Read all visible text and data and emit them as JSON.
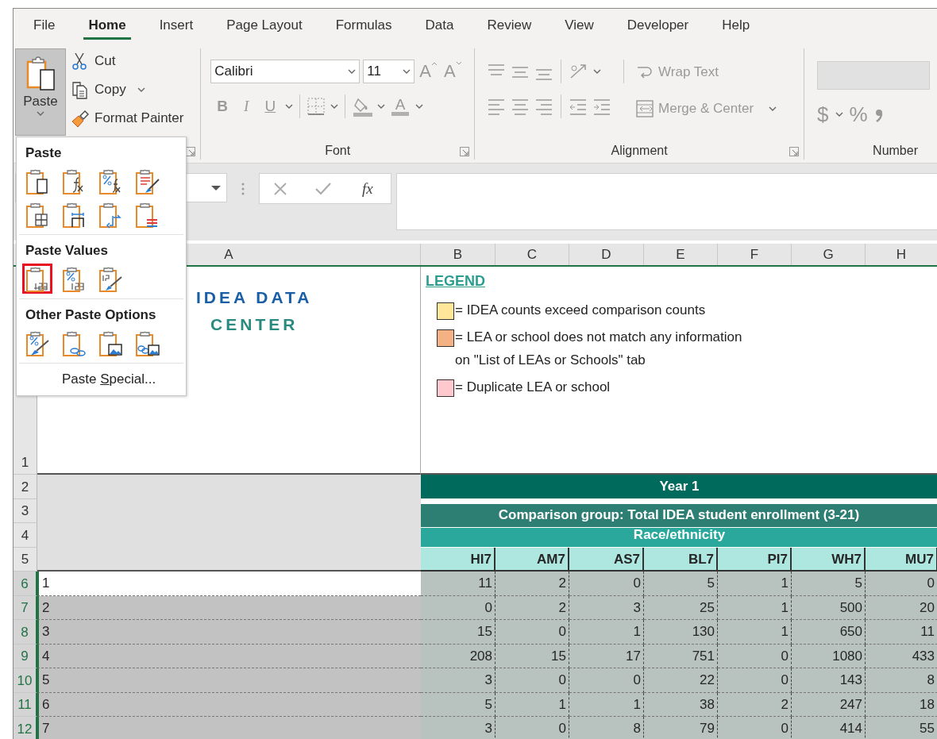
{
  "ribbon_tabs": [
    {
      "label": "File",
      "selected": false
    },
    {
      "label": "Home",
      "selected": true
    },
    {
      "label": "Insert",
      "selected": false
    },
    {
      "label": "Page Layout",
      "selected": false
    },
    {
      "label": "Formulas",
      "selected": false
    },
    {
      "label": "Data",
      "selected": false
    },
    {
      "label": "Review",
      "selected": false
    },
    {
      "label": "View",
      "selected": false
    },
    {
      "label": "Developer",
      "selected": false
    },
    {
      "label": "Help",
      "selected": false
    }
  ],
  "clipboard": {
    "paste": {
      "label": "Paste",
      "pressed": true
    },
    "commands": [
      {
        "kind": "cut",
        "label": "Cut",
        "has_menu": false
      },
      {
        "kind": "copy",
        "label": "Copy",
        "has_menu": true
      },
      {
        "kind": "format_painter",
        "label": "Format Painter",
        "has_menu": false
      }
    ]
  },
  "font": {
    "label": "Font",
    "disabled": true,
    "font_name": "Calibri",
    "font_size": "11",
    "grow": "A",
    "shrink": "A",
    "styles": [
      {
        "kind": "bold",
        "label": "B"
      },
      {
        "kind": "italic",
        "label": "I"
      },
      {
        "kind": "underline",
        "label": "U"
      }
    ],
    "font_color": "A"
  },
  "alignment": {
    "label": "Alignment",
    "disabled": true,
    "wrap_text": "Wrap Text",
    "merge": "Merge & Center"
  },
  "number": {
    "label": "Number",
    "disabled": true,
    "currency": "$",
    "percent": "%"
  },
  "formula_bar": {
    "function": "fx"
  },
  "paste_menu": {
    "sections": [
      {
        "title": "Paste",
        "options": [
          {
            "kind": "paste",
            "highlighted": false
          },
          {
            "kind": "formulas",
            "highlighted": false
          },
          {
            "kind": "formulas_number",
            "highlighted": false
          },
          {
            "kind": "source_formatting",
            "highlighted": false
          },
          {
            "kind": "no_borders",
            "highlighted": false
          },
          {
            "kind": "column_widths",
            "highlighted": false
          },
          {
            "kind": "transpose",
            "highlighted": false
          },
          {
            "kind": "conditional",
            "highlighted": false
          }
        ]
      },
      {
        "title": "Paste Values",
        "options": [
          {
            "kind": "values",
            "highlighted": true
          },
          {
            "kind": "values_number",
            "highlighted": false
          },
          {
            "kind": "values_source",
            "highlighted": false
          }
        ]
      },
      {
        "title": "Other Paste Options",
        "options": [
          {
            "kind": "formatting",
            "highlighted": false
          },
          {
            "kind": "link",
            "highlighted": false
          },
          {
            "kind": "picture",
            "highlighted": false
          },
          {
            "kind": "linked_picture",
            "highlighted": false
          }
        ]
      }
    ],
    "footer": {
      "before": "Paste ",
      "key": "S",
      "after": "pecial..."
    }
  },
  "sheet": {
    "columns": [
      "A",
      "B",
      "C",
      "D",
      "E",
      "F",
      "G",
      "H"
    ],
    "top_row": {
      "number": "1"
    },
    "logo": {
      "line_1": "IDEA DATA",
      "line_2": "CENTER"
    },
    "legend": {
      "title": "LEGEND",
      "items": [
        {
          "color": "#ffe699",
          "text": "= IDEA counts exceed comparison counts"
        },
        {
          "color": "#f4b183",
          "text": "= LEA or school does not match any information\non \"List of LEAs or Schools\" tab"
        },
        {
          "color": "#ffc7ce",
          "text": "= Duplicate LEA or school"
        }
      ]
    },
    "band_rows": [
      {
        "number": "2",
        "text": "Year 1",
        "kind": "title"
      },
      {
        "number": "3",
        "text": "Comparison group: Total IDEA student enrollment (3-21)",
        "kind": "group"
      },
      {
        "number": "4",
        "text": "Race/ethnicity",
        "kind": "category"
      }
    ],
    "code_row": {
      "number": "5",
      "codes": [
        "HI7",
        "AM7",
        "AS7",
        "BL7",
        "PI7",
        "WH7",
        "MU7"
      ]
    },
    "data_rows": [
      {
        "number": "6",
        "label": "1",
        "values": [
          "11",
          "2",
          "0",
          "5",
          "1",
          "5",
          "0"
        ],
        "selected": true,
        "active": true
      },
      {
        "number": "7",
        "label": "2",
        "values": [
          "0",
          "2",
          "3",
          "25",
          "1",
          "500",
          "20"
        ],
        "selected": true,
        "active": false
      },
      {
        "number": "8",
        "label": "3",
        "values": [
          "15",
          "0",
          "1",
          "130",
          "1",
          "650",
          "11"
        ],
        "selected": true,
        "active": false
      },
      {
        "number": "9",
        "label": "4",
        "values": [
          "208",
          "15",
          "17",
          "751",
          "0",
          "1080",
          "433"
        ],
        "selected": true,
        "active": false
      },
      {
        "number": "10",
        "label": "5",
        "values": [
          "3",
          "0",
          "0",
          "22",
          "0",
          "143",
          "8"
        ],
        "selected": true,
        "active": false
      },
      {
        "number": "11",
        "label": "6",
        "values": [
          "5",
          "1",
          "1",
          "38",
          "2",
          "247",
          "18"
        ],
        "selected": true,
        "active": false
      },
      {
        "number": "12",
        "label": "7",
        "values": [
          "3",
          "0",
          "8",
          "79",
          "0",
          "414",
          "55"
        ],
        "selected": true,
        "active": false
      }
    ]
  }
}
